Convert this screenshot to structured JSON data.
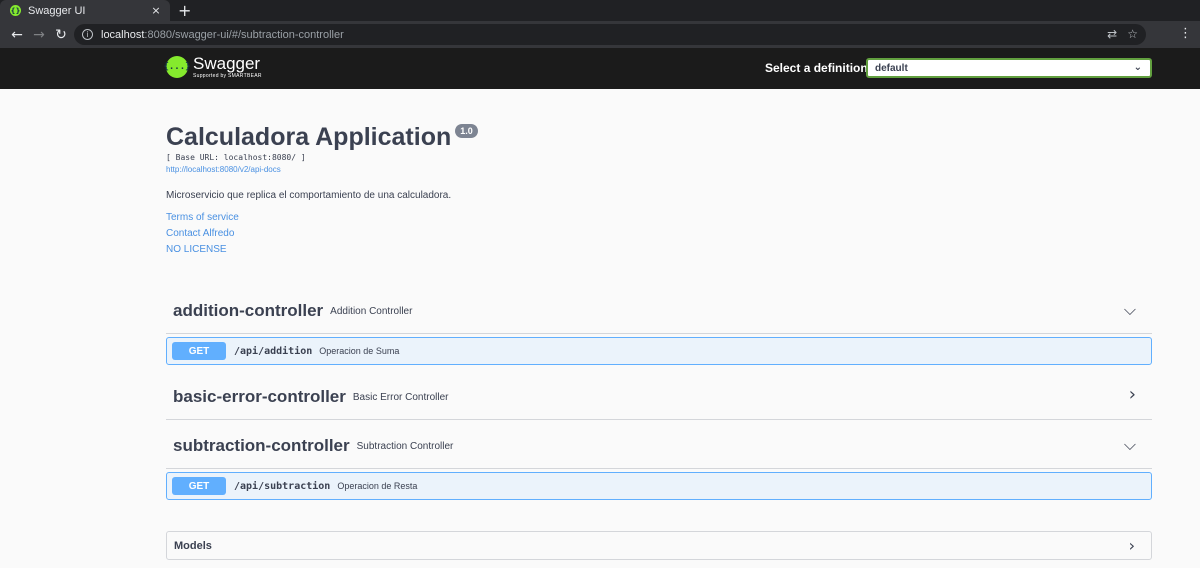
{
  "browser": {
    "tab_title": "Swagger UI",
    "tab_close": "×",
    "new_tab": "+",
    "url_host": "localhost",
    "url_rest": ":8080/swagger-ui/#/subtraction-controller",
    "back": "←",
    "forward": "→",
    "reload": "↻",
    "info_glyph": "i",
    "translate_glyph": "⇄",
    "star_glyph": "☆",
    "menu_glyph": "⋮"
  },
  "topbar": {
    "logo_glyph": "{...}",
    "logo_name": "Swagger",
    "logo_sub": "Supported by SMARTBEAR",
    "definition_label": "Select a definition",
    "definition_value": "default",
    "definition_chevron": "⌄"
  },
  "info": {
    "title": "Calculadora Application",
    "version": "1.0",
    "base_url": "[ Base URL: localhost:8080/ ]",
    "api_docs": "http://localhost:8080/v2/api-docs",
    "description": "Microservicio que replica el comportamiento de una calculadora.",
    "terms": "Terms of service",
    "contact": "Contact Alfredo",
    "license": "NO LICENSE"
  },
  "tags": [
    {
      "name": "addition-controller",
      "description": "Addition Controller",
      "chevron": "⌵"
    },
    {
      "name": "basic-error-controller",
      "description": "Basic Error Controller",
      "chevron": "›"
    },
    {
      "name": "subtraction-controller",
      "description": "Subtraction Controller",
      "chevron": "⌵"
    }
  ],
  "operations": [
    {
      "method": "GET",
      "path": "/api/addition",
      "summary": "Operacion de Suma"
    },
    {
      "method": "GET",
      "path": "/api/subtraction",
      "summary": "Operacion de Resta"
    }
  ],
  "models": {
    "title": "Models",
    "chevron": "›"
  },
  "colors": {
    "get_method": "#61affe",
    "get_background": "#ebf3fb",
    "link": "#4990e2",
    "topbar": "#1b1b1b",
    "logo_green": "#85ea2d"
  }
}
